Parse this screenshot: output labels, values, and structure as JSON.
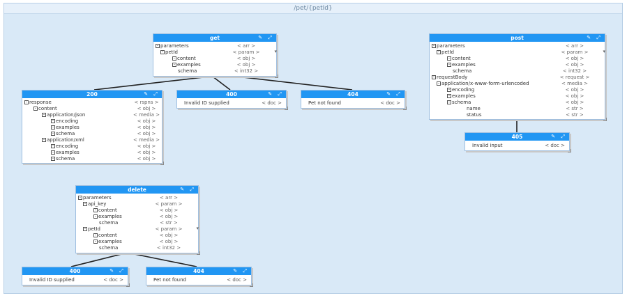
{
  "group": {
    "title": "/pet/{petId}"
  },
  "tools": "✎ ⤢",
  "nodes": {
    "get": {
      "title": "get",
      "rows": [
        {
          "label": "parameters",
          "value": "<    arr    >"
        },
        {
          "label": "petId",
          "value": "<  param  >"
        },
        {
          "label": "content",
          "value": "<    obj    >"
        },
        {
          "label": "examples",
          "value": "<    obj    >"
        },
        {
          "label": "schema",
          "value": "<   int32   >"
        }
      ]
    },
    "post": {
      "title": "post",
      "rows": [
        {
          "label": "parameters",
          "value": "<    arr    >"
        },
        {
          "label": "petId",
          "value": "<  param  >"
        },
        {
          "label": "content",
          "value": "<    obj    >"
        },
        {
          "label": "examples",
          "value": "<    obj    >"
        },
        {
          "label": "schema",
          "value": "<   int32   >"
        },
        {
          "label": "requestBody",
          "value": "< request >"
        },
        {
          "label": "application/x-www-form-urlencoded",
          "value": "<  media  >"
        },
        {
          "label": "encoding",
          "value": "<    obj    >"
        },
        {
          "label": "examples",
          "value": "<    obj    >"
        },
        {
          "label": "schema",
          "value": "<    obj    >"
        },
        {
          "label": "name",
          "value": "<    str    >"
        },
        {
          "label": "status",
          "value": "<    str    >"
        }
      ]
    },
    "r200": {
      "title": "200",
      "rows": [
        {
          "label": "response",
          "value": "<   rspns   >"
        },
        {
          "label": "content",
          "value": "<    obj    >"
        },
        {
          "label": "application/json",
          "value": "<  media  >"
        },
        {
          "label": "encoding",
          "value": "<    obj    >"
        },
        {
          "label": "examples",
          "value": "<    obj    >"
        },
        {
          "label": "schema",
          "value": "<    obj    >"
        },
        {
          "label": "application/xml",
          "value": "<  media  >"
        },
        {
          "label": "encoding",
          "value": "<    obj    >"
        },
        {
          "label": "examples",
          "value": "<    obj    >"
        },
        {
          "label": "schema",
          "value": "<    obj    >"
        }
      ]
    },
    "get400": {
      "title": "400",
      "label": "Invalid ID supplied",
      "value": "<   doc   >"
    },
    "get404": {
      "title": "404",
      "label": "Pet not found",
      "value": "<   doc   >"
    },
    "post405": {
      "title": "405",
      "label": "Invalid input",
      "value": "<   doc   >"
    },
    "delete": {
      "title": "delete",
      "rows": [
        {
          "label": "parameters",
          "value": "<    arr    >"
        },
        {
          "label": "api_key",
          "value": "<  param  >"
        },
        {
          "label": "content",
          "value": "<    obj    >"
        },
        {
          "label": "examples",
          "value": "<    obj    >"
        },
        {
          "label": "schema",
          "value": "<    str    >"
        },
        {
          "label": "petId",
          "value": "<  param  >"
        },
        {
          "label": "content",
          "value": "<    obj    >"
        },
        {
          "label": "examples",
          "value": "<    obj    >"
        },
        {
          "label": "schema",
          "value": "<   int32   >"
        }
      ]
    },
    "del400": {
      "title": "400",
      "label": "Invalid ID supplied",
      "value": "<   doc   >"
    },
    "del404": {
      "title": "404",
      "label": "Pet not found",
      "value": "<   doc   >"
    }
  }
}
